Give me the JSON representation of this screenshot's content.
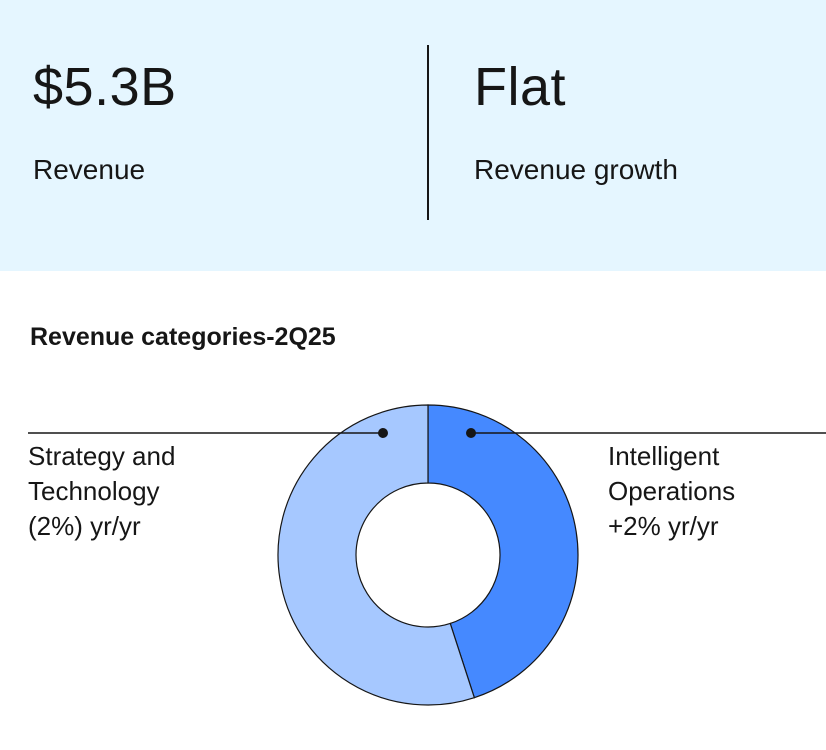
{
  "kpis": {
    "revenue": {
      "value": "$5.3B",
      "label": "Revenue"
    },
    "growth": {
      "value": "Flat",
      "label": "Revenue growth"
    }
  },
  "section": {
    "title": "Revenue categories-2Q25"
  },
  "colors": {
    "panel_background": "#e5f6ff",
    "strategy_and_technology": "#a6c8ff",
    "intelligent_operations": "#4589ff",
    "outline": "#161616"
  },
  "chart_data": {
    "type": "pie",
    "variant": "donut",
    "title": "Revenue categories-2Q25",
    "series": [
      {
        "name": "Strategy and Technology",
        "share_of_revenue_percent": 55,
        "growth_label": "(2%) yr/yr",
        "growth_percent": -2,
        "color": "#a6c8ff"
      },
      {
        "name": "Intelligent Operations",
        "share_of_revenue_percent": 45,
        "growth_label": "+2% yr/yr",
        "growth_percent": 2,
        "color": "#4589ff"
      }
    ],
    "labels": {
      "left": "Strategy and\nTechnology\n(2%) yr/yr",
      "right": "Intelligent\nOperations\n+2% yr/yr"
    }
  }
}
